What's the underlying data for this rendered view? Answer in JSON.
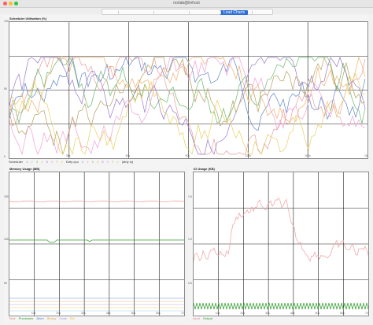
{
  "window": {
    "title": "norlab@linhost"
  },
  "toolbar": {
    "active_tab": "Load Charts"
  },
  "scheduler": {
    "title": "Scheduler Utilisation (%)",
    "ticks": [
      "100",
      "50",
      "0"
    ],
    "legend_title": "Scheduler",
    "legend_items": [
      "1",
      "2",
      "3",
      "4",
      "5",
      "6",
      "7",
      "8"
    ],
    "legend_dirty": "Dirty cpu",
    "legend_dirty_items": [
      "1",
      "2",
      "3",
      "4",
      "5",
      "6",
      "7",
      "8"
    ],
    "legend_extra": "(dirty io)",
    "x_labels": [
      "30s",
      "60s",
      "90s",
      "120s",
      "150s",
      "180s"
    ]
  },
  "memory": {
    "title": "Memory Usage (MB)",
    "ticks": [
      "150",
      "100",
      "50"
    ],
    "legend": [
      "Total",
      "Processes",
      "Atom",
      "Binary",
      "Code",
      "Ets"
    ],
    "x_labels": [
      "10s",
      "20s",
      "30s",
      "40s",
      "50s",
      "60s",
      "70s"
    ]
  },
  "io": {
    "title": "IO Usage (KB)",
    "ticks": [
      "1.5",
      "1.0",
      "0.5"
    ],
    "legend": [
      "Input",
      "Output"
    ],
    "x_labels": [
      "10s",
      "20s",
      "30s",
      "40s",
      "50s",
      "60s",
      "70s"
    ]
  },
  "colors": {
    "sched": [
      "#5e86c8",
      "#e8a0a0",
      "#6cb86c",
      "#f0b06e",
      "#9a79c8",
      "#f2a0d4",
      "#b8a060",
      "#e8d060"
    ],
    "mem_total": "#f0a0a0",
    "mem_proc": "#3aa03a",
    "io_input": "#f0a0a0",
    "io_output": "#2a9a2a"
  }
}
